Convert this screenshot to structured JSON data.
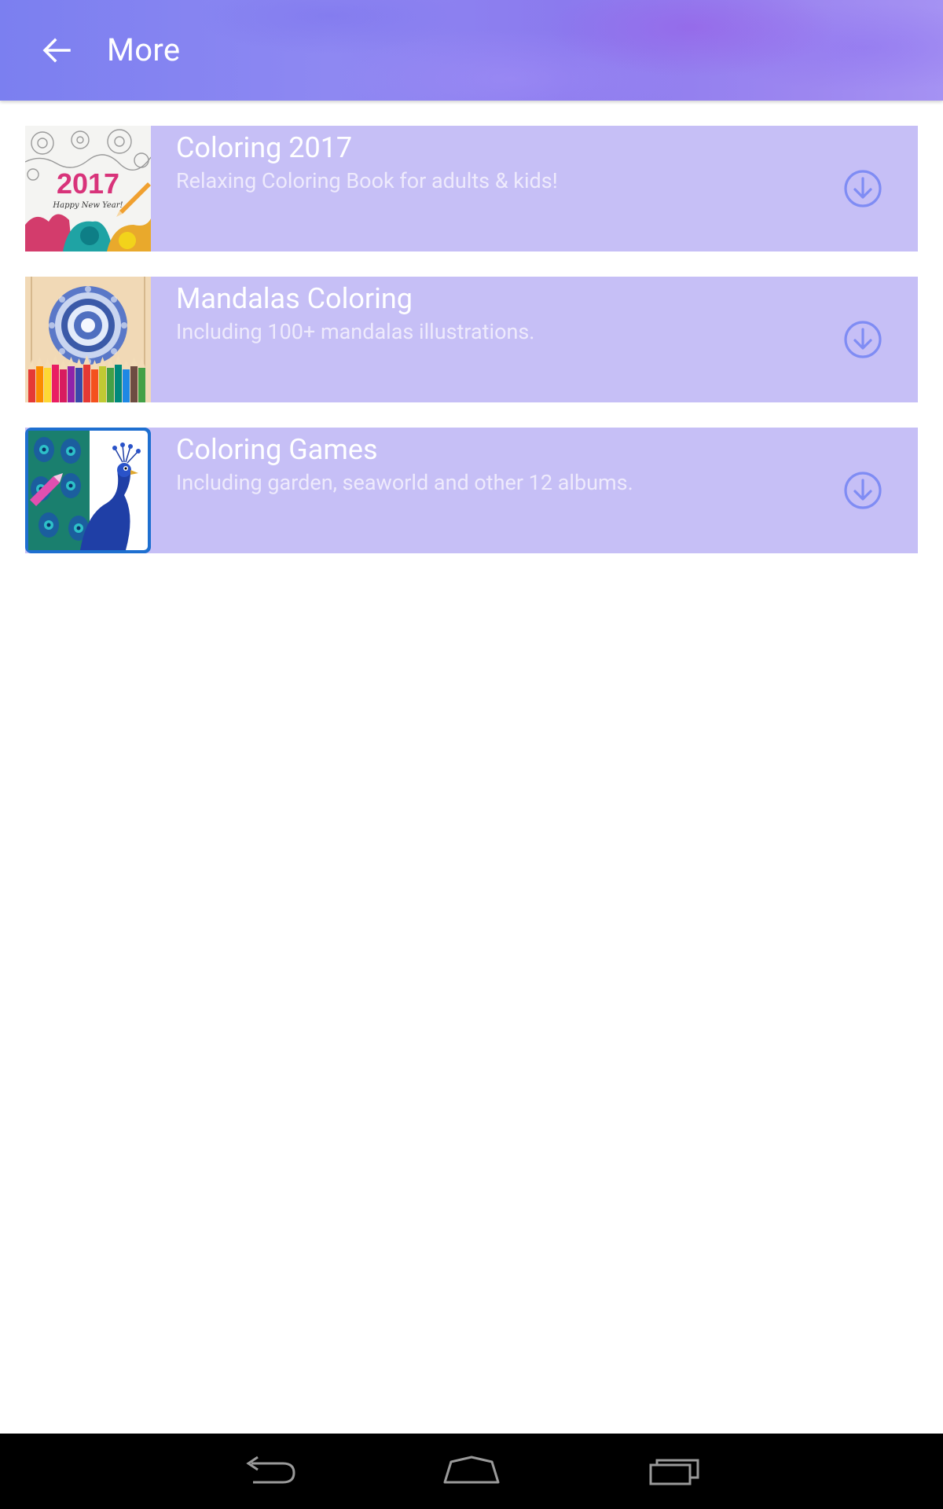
{
  "header": {
    "title": "More",
    "back_icon": "arrow-back-icon"
  },
  "apps": [
    {
      "title": "Coloring 2017",
      "subtitle": "Relaxing Coloring Book for adults & kids!",
      "thumbnail_text": "2017",
      "thumbnail_caption": "Happy New Year!",
      "action_icon": "download-icon"
    },
    {
      "title": "Mandalas Coloring",
      "subtitle": "Including 100+ mandalas illustrations.",
      "thumbnail": "mandala-pencils-thumbnail",
      "action_icon": "download-icon"
    },
    {
      "title": "Coloring Games",
      "subtitle": "Including garden, seaworld and other 12 albums.",
      "thumbnail": "peacock-thumbnail",
      "action_icon": "download-icon"
    }
  ],
  "colors": {
    "row_background": "#c6bff6",
    "accent": "#7b7ff0",
    "download_icon": "#7f8cf4",
    "nav_bar": "#000000"
  },
  "nav_bar": {
    "buttons": [
      "back-nav-icon",
      "home-nav-icon",
      "recents-nav-icon"
    ]
  }
}
